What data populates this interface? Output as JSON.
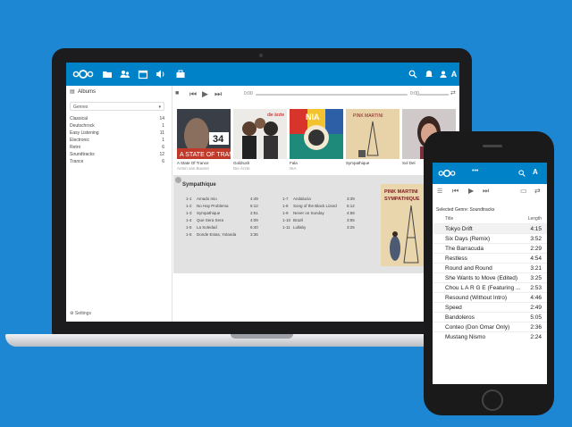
{
  "colors": {
    "background": "#1d87d4",
    "brand": "#0082c9",
    "panel": "#e2e2e2"
  },
  "desktop": {
    "header_icons": [
      "files-icon",
      "contacts-icon",
      "calendar-icon",
      "music-icon",
      "briefcase-icon",
      "search-icon",
      "notifications-icon",
      "contacts-menu-icon",
      "user-avatar"
    ],
    "avatar_letter": "A",
    "sidebar": {
      "title": "Albums",
      "genre_select": "Genres",
      "genres": [
        {
          "name": "Classical",
          "count": "14"
        },
        {
          "name": "Deutschrock",
          "count": "1"
        },
        {
          "name": "Easy Listening",
          "count": "11"
        },
        {
          "name": "Electronic",
          "count": "1"
        },
        {
          "name": "Retro",
          "count": "6"
        },
        {
          "name": "Soundtracks",
          "count": "12"
        },
        {
          "name": "Trance",
          "count": "6"
        }
      ],
      "settings": "Settings"
    },
    "player": {
      "time_current": "0:00",
      "time_total": "0:00"
    },
    "albums": [
      {
        "title": "A State Of Trance",
        "artist": "Armin van Buuren"
      },
      {
        "title": "Goldrush",
        "artist": "Die Ärzte"
      },
      {
        "title": "Fala",
        "artist": "NIA"
      },
      {
        "title": "Sympathique",
        "artist": "Pink Martini"
      },
      {
        "title": "Sol Del",
        "artist": "Inna"
      }
    ],
    "details": {
      "title": "Sympathique",
      "tracks_left": [
        {
          "n": "1-1",
          "t": "Amado mio",
          "d": "4:49"
        },
        {
          "n": "1-2",
          "t": "No Hay Problema",
          "d": "6:12"
        },
        {
          "n": "1-3",
          "t": "Sympathique",
          "d": "2:51"
        },
        {
          "n": "1-4",
          "t": "Que Sera Sera",
          "d": "4:09"
        },
        {
          "n": "1-5",
          "t": "La Soledad",
          "d": "6:40"
        },
        {
          "n": "1-6",
          "t": "Donde Estas, Yolanda",
          "d": "3:36"
        }
      ],
      "tracks_right": [
        {
          "n": "1-7",
          "t": "Andalucia",
          "d": "3:39"
        },
        {
          "n": "1-8",
          "t": "Song of the Black Lizard",
          "d": "5:12"
        },
        {
          "n": "1-9",
          "t": "Never on Sunday",
          "d": "4:58"
        },
        {
          "n": "1-10",
          "t": "Brazil",
          "d": "3:55"
        },
        {
          "n": "1-11",
          "t": "Lullaby",
          "d": "3:25"
        }
      ],
      "cover_text": [
        "PINK MARTINI",
        "SYMPATHIQUE"
      ]
    }
  },
  "phone": {
    "avatar_letter": "A",
    "genre_title": "Selected Genre: Soundtracks",
    "col_title": "Title",
    "col_length": "Length",
    "tracks": [
      {
        "t": "Tokyo Drift",
        "d": "4:15"
      },
      {
        "t": "Six Days (Remix)",
        "d": "3:52"
      },
      {
        "t": "The Barracuda",
        "d": "2:29"
      },
      {
        "t": "Restless",
        "d": "4:54"
      },
      {
        "t": "Round and Round",
        "d": "3:21"
      },
      {
        "t": "She Wants to Move (Edited)",
        "d": "3:25"
      },
      {
        "t": "Chou L A R G E (Featuring ...",
        "d": "2:53"
      },
      {
        "t": "Resound (Without Intro)",
        "d": "4:46"
      },
      {
        "t": "Speed",
        "d": "2:49"
      },
      {
        "t": "Bandoleros",
        "d": "5:05"
      },
      {
        "t": "Conteo (Don Omar Only)",
        "d": "2:36"
      },
      {
        "t": "Mustang Nismo",
        "d": "2:24"
      }
    ]
  }
}
